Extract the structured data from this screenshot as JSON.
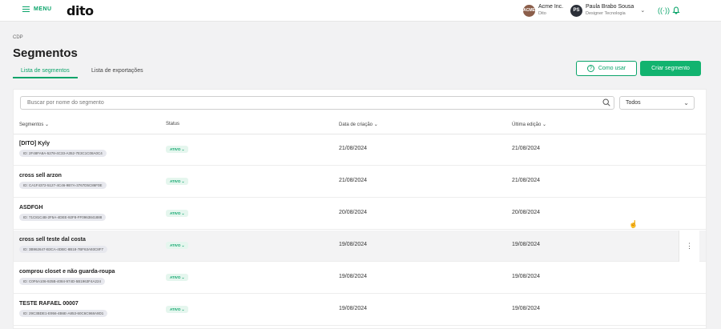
{
  "topbar": {
    "menu_label": "MENU",
    "logo": "dito",
    "org": {
      "avatar": "ACME",
      "name": "Acme Inc.",
      "sub": "Dito"
    },
    "user": {
      "avatar": "PS",
      "name": "Paula Brabo Sousa",
      "role": "Designer Tecnologia"
    }
  },
  "breadcrumb": "CDP",
  "page_title": "Segmentos",
  "tabs": [
    {
      "label": "Lista de segmentos",
      "active": true
    },
    {
      "label": "Lista de exportações",
      "active": false
    }
  ],
  "buttons": {
    "help": "Como usar",
    "create": "Criar segmento"
  },
  "search": {
    "placeholder": "Buscar por nome do segmento"
  },
  "filter": {
    "value": "Todos"
  },
  "columns": {
    "segments": "Segmentos",
    "status": "Status",
    "created": "Data de criação",
    "edited": "Última edição"
  },
  "rows": [
    {
      "name": "[DITO] Kyly",
      "id": "ID: 2F48FA8A-5278-4C33-A352-7E3C1C08A0C4",
      "status": "ATIVO",
      "created": "21/08/2024",
      "edited": "21/08/2024"
    },
    {
      "name": "cross sell arzon",
      "id": "ID: CA1F4372-5127-4C46-9B7A-3767D5C86F0E",
      "status": "ATIVO",
      "created": "21/08/2024",
      "edited": "21/08/2024"
    },
    {
      "name": "ASDFGH",
      "id": "ID: 71C81C4B-2F5A-4DEE-92F8-FF0963841888",
      "status": "ATIVO",
      "created": "20/08/2024",
      "edited": "20/08/2024"
    },
    {
      "name": "cross sell teste dal costa",
      "id": "ID: 3B962647-B3CA-4DBC-8B18-7BF63A93C8F7",
      "status": "ATIVO",
      "created": "19/08/2024",
      "edited": "19/08/2024"
    },
    {
      "name": "comprou closet e não guarda-roupa",
      "id": "ID: C0F6A106-925B-4084-974D-5B1963F4A224",
      "status": "ATIVO",
      "created": "19/08/2024",
      "edited": "19/08/2024"
    },
    {
      "name": "TESTE RAFAEL 00007",
      "id": "ID: 29C3BDE1-E956-4B6E-A853-60C6C968A9D1",
      "status": "ATIVO",
      "created": "19/08/2024",
      "edited": "19/08/2024"
    }
  ],
  "colors": {
    "accent": "#12b36f",
    "accent_dark": "#0aa46a",
    "background": "#f2f2f3"
  }
}
